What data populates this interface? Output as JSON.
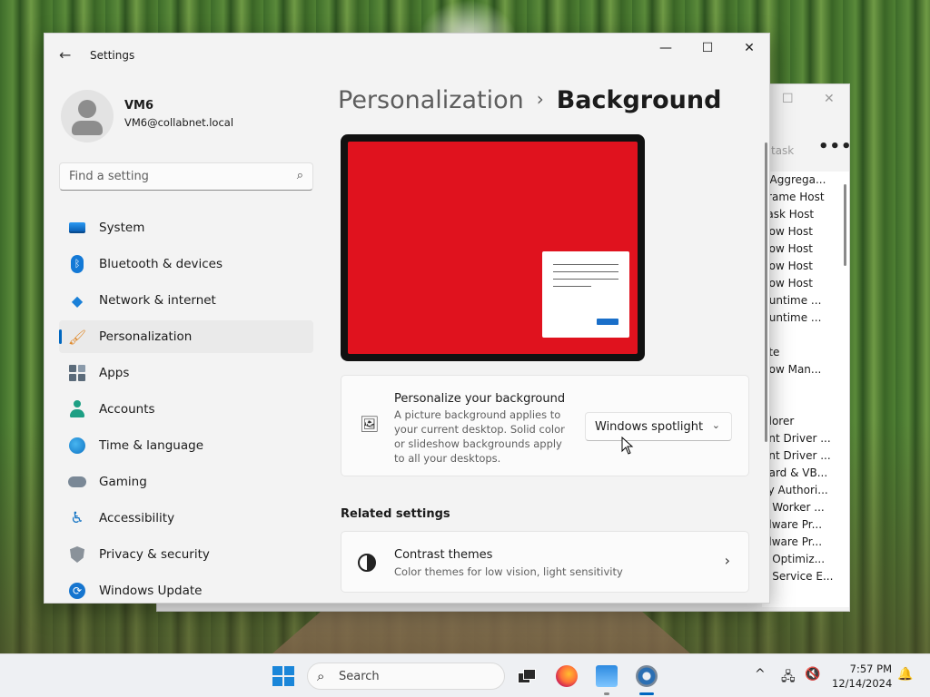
{
  "settings": {
    "app_title": "Settings",
    "user": {
      "name": "VM6",
      "email": "VM6@collabnet.local"
    },
    "search_placeholder": "Find a setting",
    "nav": [
      {
        "label": "System",
        "icon": "system-icon"
      },
      {
        "label": "Bluetooth & devices",
        "icon": "bluetooth-icon"
      },
      {
        "label": "Network & internet",
        "icon": "network-icon"
      },
      {
        "label": "Personalization",
        "icon": "paintbrush-icon",
        "active": true
      },
      {
        "label": "Apps",
        "icon": "apps-icon"
      },
      {
        "label": "Accounts",
        "icon": "accounts-icon"
      },
      {
        "label": "Time & language",
        "icon": "globe-clock-icon"
      },
      {
        "label": "Gaming",
        "icon": "gamepad-icon"
      },
      {
        "label": "Accessibility",
        "icon": "accessibility-icon"
      },
      {
        "label": "Privacy & security",
        "icon": "shield-icon"
      },
      {
        "label": "Windows Update",
        "icon": "update-icon"
      }
    ],
    "breadcrumb": {
      "parent": "Personalization",
      "current": "Background"
    },
    "background_card": {
      "title": "Personalize your background",
      "description": "A picture background applies to your current desktop. Solid color or slideshow backgrounds apply to all your desktops.",
      "selected": "Windows spotlight"
    },
    "related_title": "Related settings",
    "contrast_card": {
      "title": "Contrast themes",
      "description": "Color themes for low vision, light sensitivity"
    },
    "preview_color": "#e0121e",
    "accent_color": "#0067c0"
  },
  "task_manager": {
    "task_label": "task",
    "rows": [
      ") Aggrega...",
      "Frame Host",
      "Task Host",
      "dow Host",
      "dow Host",
      "dow Host",
      "dow Host",
      "Runtime ...",
      "Runtime ...",
      "",
      "ate",
      "dow Man...",
      "",
      "",
      "plorer",
      "ont Driver ...",
      "ont Driver ...",
      "uard & VB...",
      "cy Authori...",
      "e Worker ...",
      "alware Pr...",
      "alware Pr...",
      "e Optimiz...",
      "e Service E..."
    ]
  },
  "taskbar": {
    "search_label": "Search",
    "time": "7:57 PM",
    "date": "12/14/2024"
  }
}
